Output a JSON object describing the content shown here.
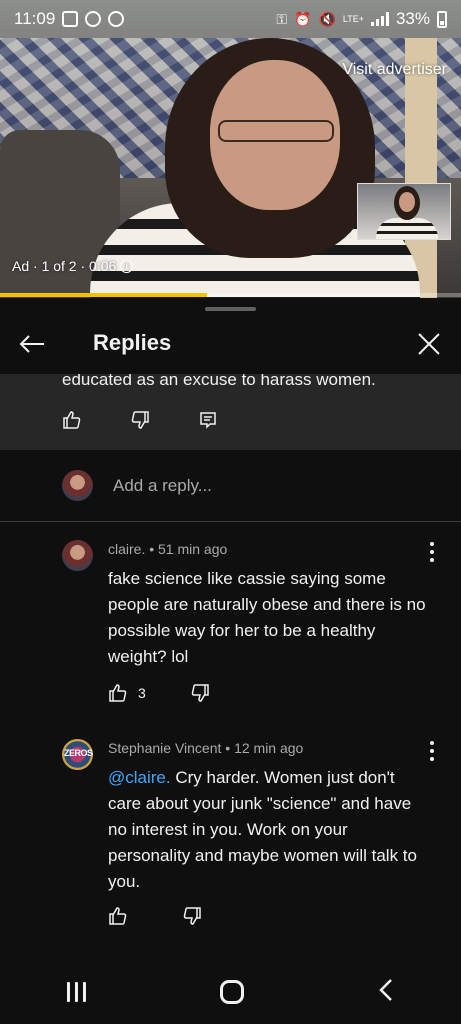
{
  "status_bar": {
    "time": "11:09",
    "battery": "33%",
    "network": "LTE+"
  },
  "ad": {
    "visit_label": "Visit advertiser",
    "info_text": "Ad · 1 of 2 · 0:06",
    "progress": 0.45,
    "progress_color": "#f2c200"
  },
  "header": {
    "title": "Replies",
    "back_icon": "arrow-left-icon",
    "close_icon": "close-icon"
  },
  "parent_comment": {
    "text_tail": "educated as an excuse to harass women."
  },
  "add_reply": {
    "placeholder": "Add a reply..."
  },
  "replies": [
    {
      "author": "claire.",
      "time": "51 min ago",
      "meta": "claire. • 51 min ago",
      "mention": "",
      "text": "fake science like cassie saying some people are naturally obese and there is no possible way for her to be a healthy weight? lol",
      "likes": "3"
    },
    {
      "author": "Stephanie Vincent",
      "time": "12 min ago",
      "meta": "Stephanie Vincent • 12 min ago",
      "mention": "@claire.",
      "text": "Cry harder. Women just don't care about your junk \"science\" and have no interest in you. Work on your personality and maybe women will talk to you.",
      "likes": "",
      "avatar_text": "ZEROS"
    }
  ],
  "colors": {
    "background": "#0f0f0f",
    "parent_bg": "#272727",
    "link": "#3ea6ff",
    "secondary_text": "#aaaaaa"
  }
}
